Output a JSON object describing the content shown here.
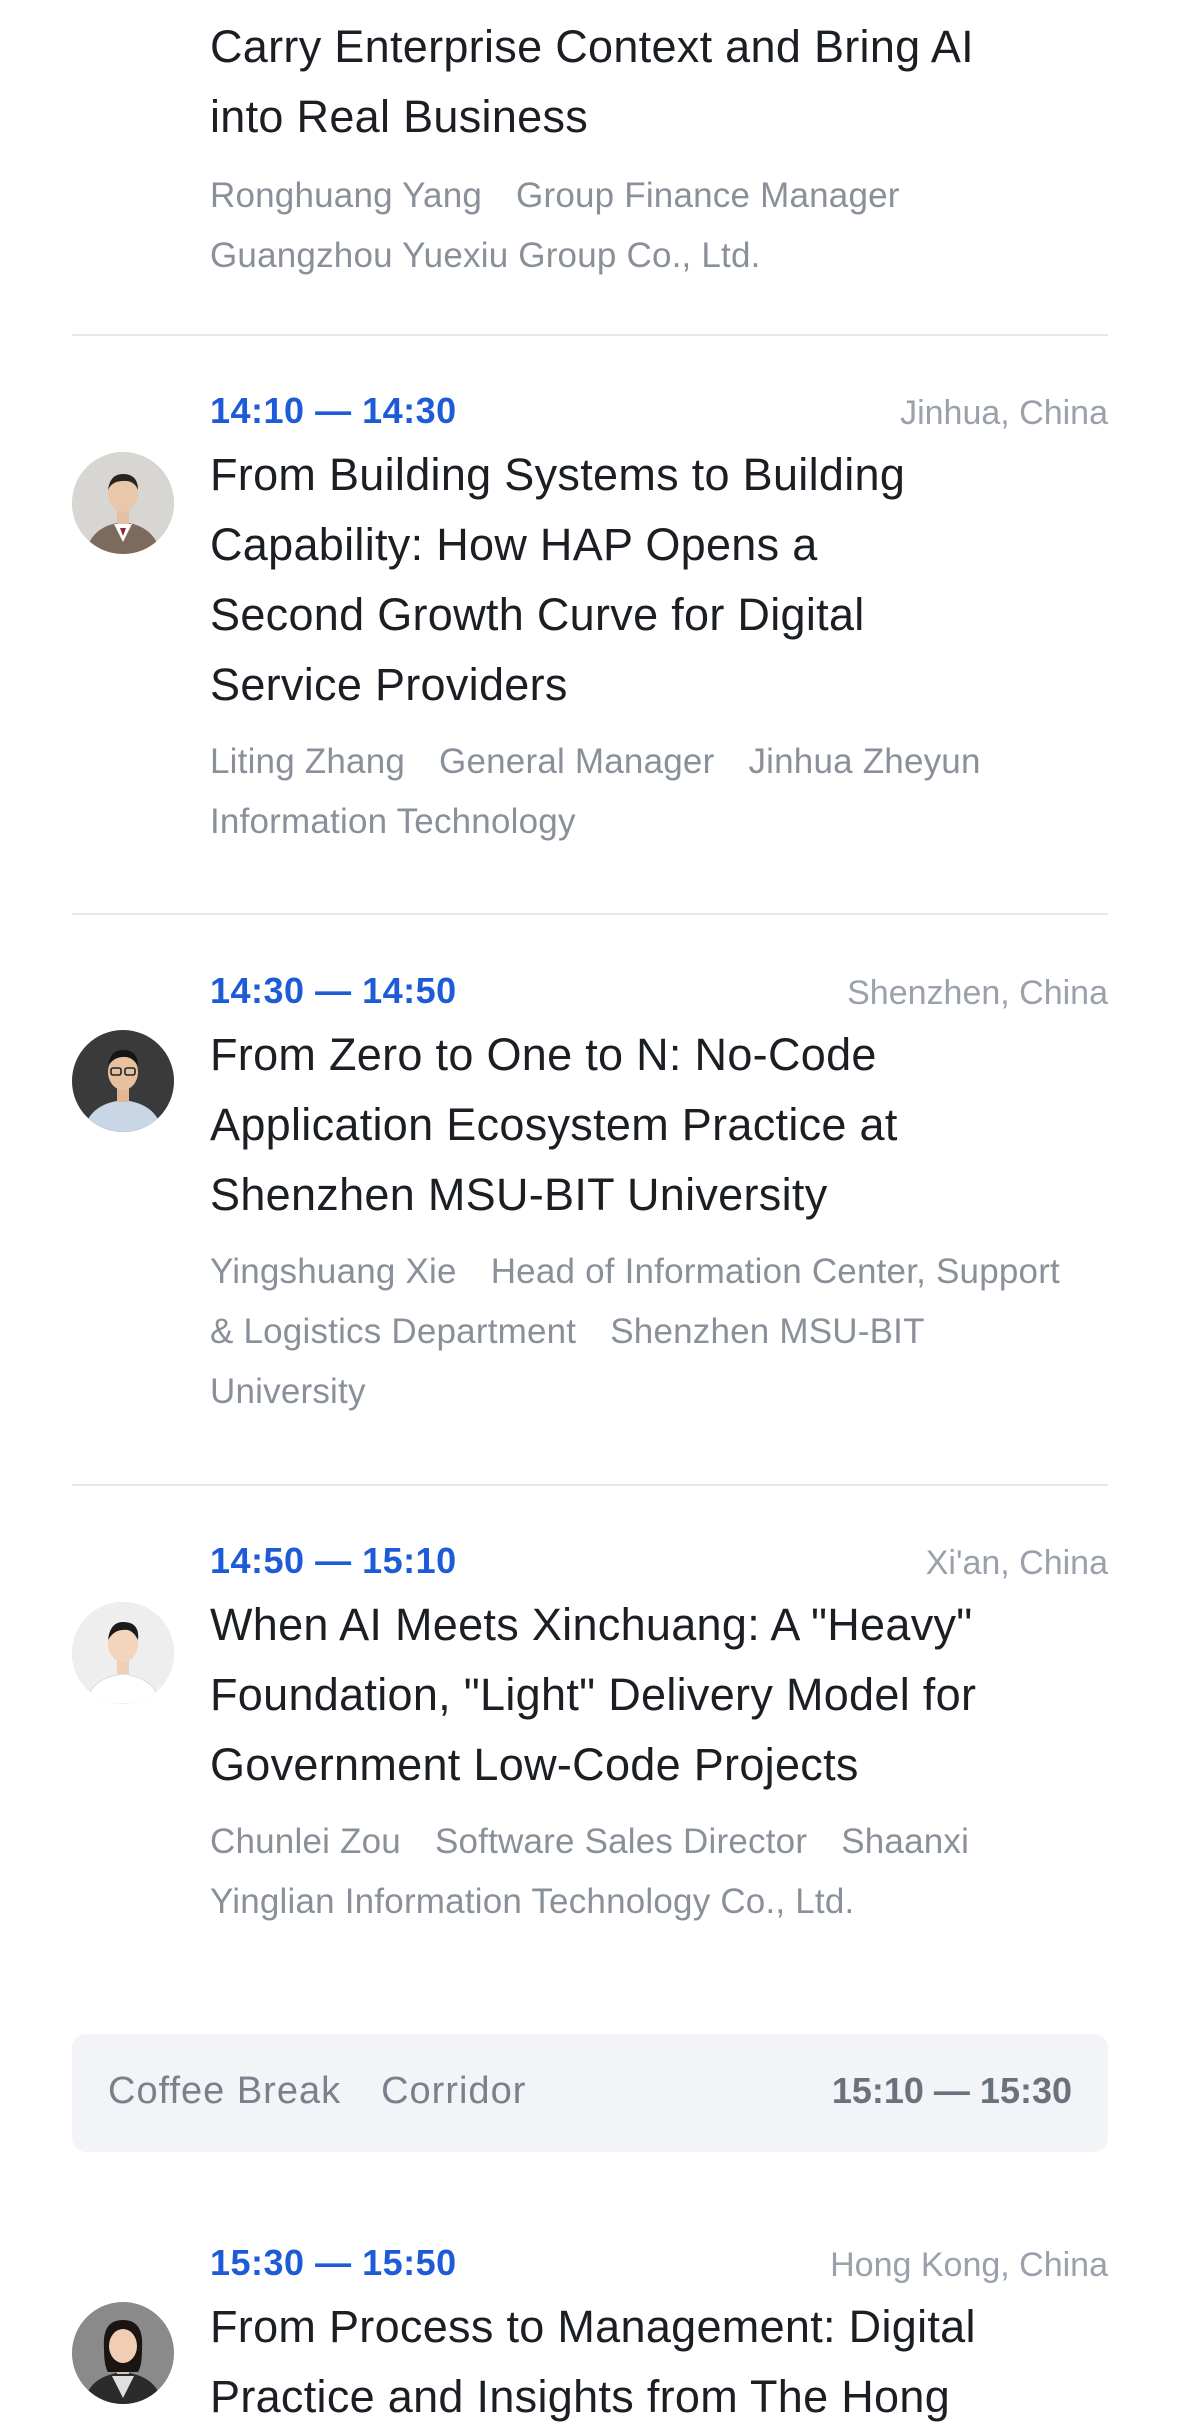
{
  "sessions": [
    {
      "title_lines": [
        "Carry Enterprise Context and Bring AI",
        "into Real Business"
      ],
      "speaker": "Ronghuang Yang",
      "role": "Group Finance Manager",
      "company": "Guangzhou Yuexiu Group Co., Ltd."
    },
    {
      "time": "14:10 — 14:30",
      "location": "Jinhua, China",
      "title_lines": [
        "From Building Systems to Building",
        "Capability: How HAP Opens a",
        "Second Growth Curve for Digital",
        "Service Providers"
      ],
      "speaker": "Liting Zhang",
      "role": "General Manager",
      "company": "Jinhua Zheyun Information Technology"
    },
    {
      "time": "14:30 — 14:50",
      "location": "Shenzhen, China",
      "title_lines": [
        "From Zero to One to N: No-Code",
        "Application Ecosystem Practice at",
        "Shenzhen MSU-BIT University"
      ],
      "speaker": "Yingshuang Xie",
      "role": "Head of Information Center, Support & Logistics Department",
      "company": "Shenzhen MSU-BIT University"
    },
    {
      "time": "14:50 — 15:10",
      "location": "Xi'an, China",
      "title_lines": [
        "When AI Meets Xinchuang: A \"Heavy\"",
        "Foundation, \"Light\" Delivery Model for",
        "Government Low-Code Projects"
      ],
      "speaker": "Chunlei Zou",
      "role": "Software Sales Director",
      "company": "Shaanxi Yinglian Information Technology Co., Ltd."
    },
    {
      "time": "15:30 — 15:50",
      "location": "Hong Kong, China",
      "title_lines": [
        "From Process to Management: Digital",
        "Practice and Insights from The Hong"
      ]
    }
  ],
  "coffee_break": {
    "label": "Coffee Break",
    "place": "Corridor",
    "time": "15:10 — 15:30"
  }
}
